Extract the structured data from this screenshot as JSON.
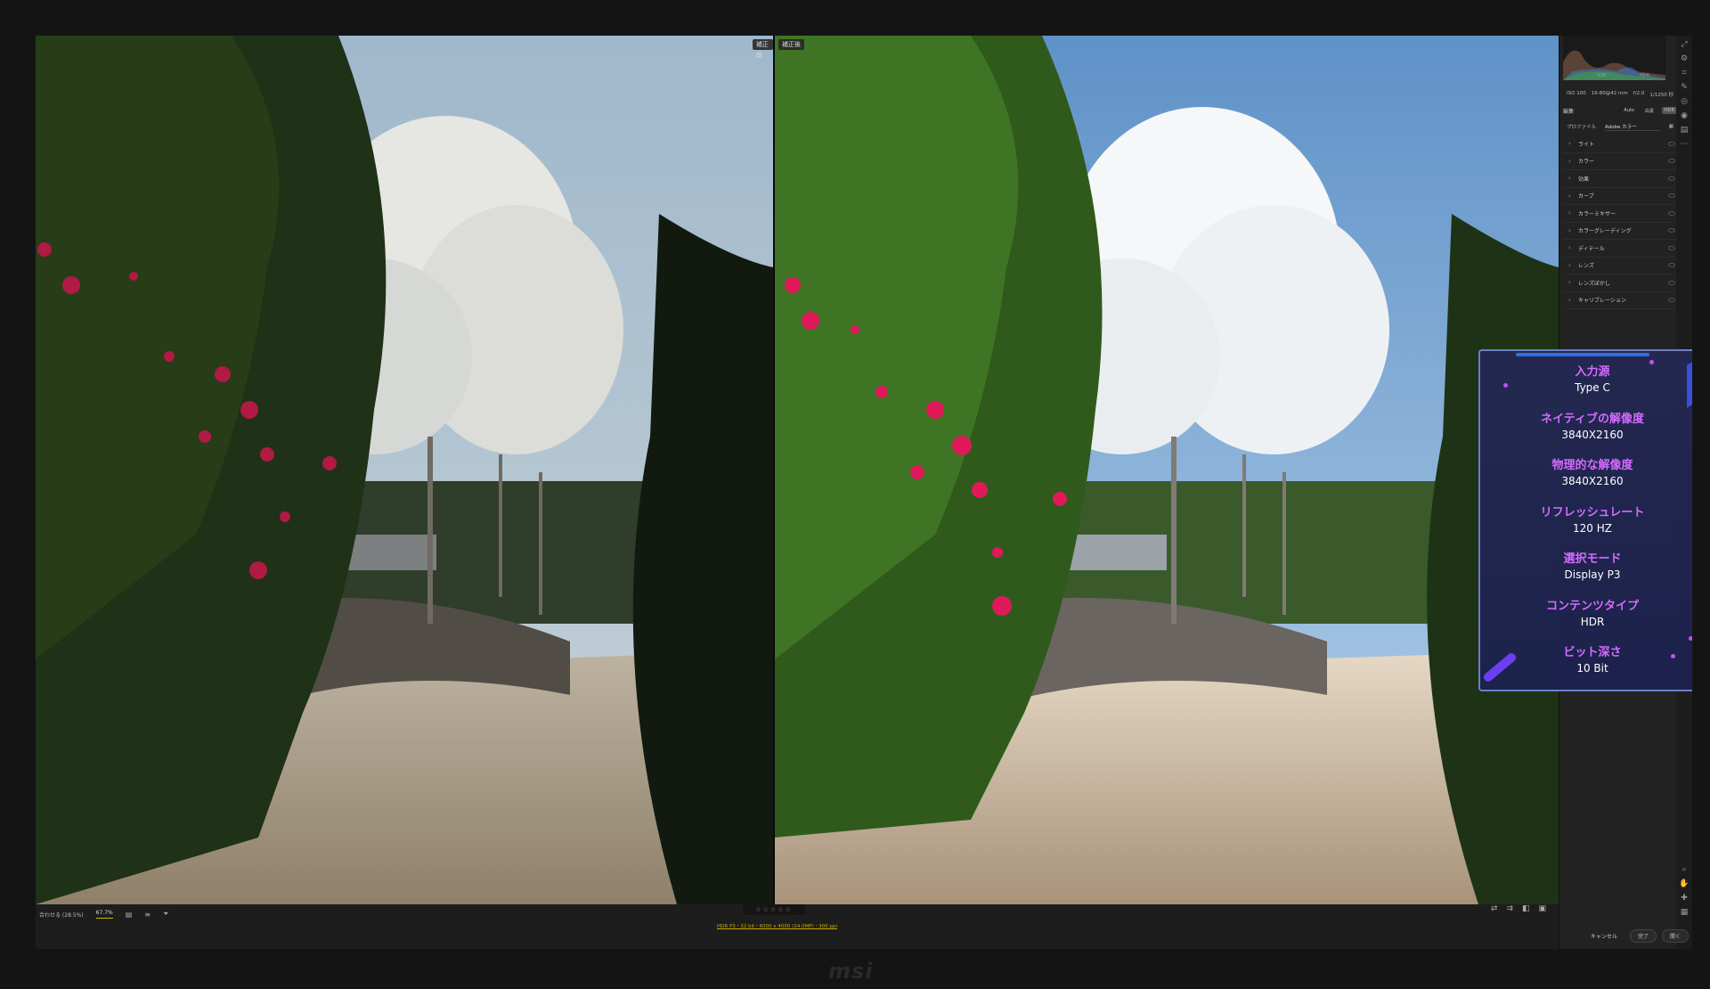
{
  "panes": {
    "before_tag": "補正前",
    "after_tag": "補正後"
  },
  "osd": {
    "items": [
      {
        "label": "入力源",
        "value": "Type C"
      },
      {
        "label": "ネイティブの解像度",
        "value": "3840X2160"
      },
      {
        "label": "物理的な解像度",
        "value": "3840X2160"
      },
      {
        "label": "リフレッシュレート",
        "value": "120 HZ"
      },
      {
        "label": "選択モード",
        "value": "Display P3"
      },
      {
        "label": "コンテンツタイプ",
        "value": "HDR"
      },
      {
        "label": "ビット深さ",
        "value": "10 Bit"
      }
    ],
    "colors": {
      "label": "#d36cff",
      "value": "#ffffff",
      "border": "#6a7fc7"
    }
  },
  "panel": {
    "histogram": {
      "sdr_label": "SDR",
      "hdr_label": "HDR"
    },
    "camera": {
      "iso": "ISO 100",
      "focal": "16-80@42 mm",
      "aperture": "f/2.0",
      "shutter": "1/1250 秒"
    },
    "edit": {
      "label": "編集",
      "auto": "Auto",
      "bw": "白黒",
      "hdr": "HDR"
    },
    "profile": {
      "label": "プロファイル",
      "value": "Adobe カラー"
    },
    "sections": [
      "ライト",
      "カラー",
      "効果",
      "カーブ",
      "カラーミキサー",
      "カラーグレーディング",
      "ディテール",
      "レンズ",
      "レンズぼかし",
      "キャリブレーション"
    ]
  },
  "bottombar": {
    "fit_label": "合わせる (28.5%)",
    "zoom_value": "67.7%",
    "stars": "☆☆☆☆☆",
    "file_info": "HDR P3・32 bit・6000 x 4000 (24.0MP)・300 ppi"
  },
  "actions": {
    "cancel": "キャンセル",
    "done": "完了",
    "open": "開く"
  },
  "brand": "msi"
}
